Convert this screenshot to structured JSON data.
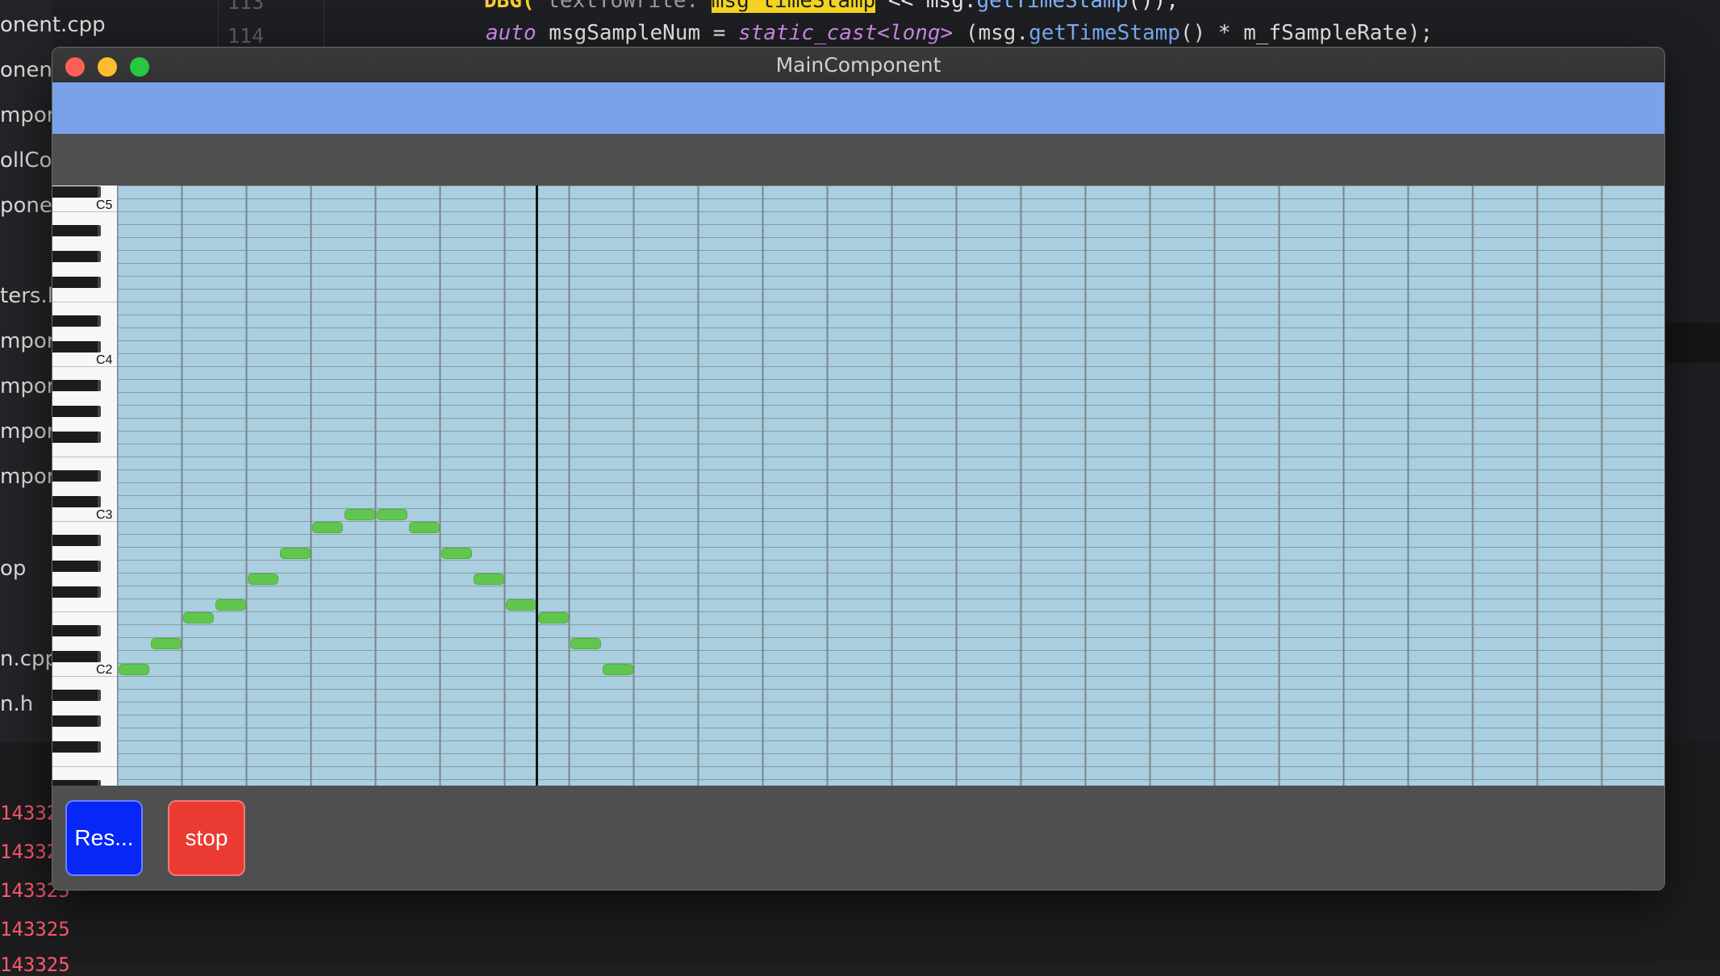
{
  "ide": {
    "line_numbers": [
      "113",
      "114"
    ],
    "code_line_top": {
      "prefix": "DBG(",
      "mid": " textToWrite: ",
      "highlight": "msg timeStamp",
      "rest": " << msg.",
      "fn": "getTimeStamp",
      "end": "());"
    },
    "code_line": {
      "kw": "auto",
      "var": " msgSampleNum = ",
      "cast": "static_cast",
      "type": "<long>",
      "open": " (msg.",
      "fn": "getTimeStamp",
      "rest": "() * m_fSampleRate);"
    },
    "files": [
      "onent.cpp",
      "onent",
      "mpon",
      "ollCo",
      "poner",
      "ters.l",
      "mpor",
      "mpor",
      "mpor",
      "mpor",
      "op",
      "n.cpp",
      "n.h"
    ],
    "console": [
      "14332",
      "14332",
      "143325",
      "143325",
      "143325"
    ]
  },
  "window": {
    "title": "MainComponent"
  },
  "piano_roll": {
    "octave_labels": [
      "C5",
      "C4",
      "C3",
      "C2"
    ],
    "playhead_beat": 6.5,
    "notes": [
      {
        "beat": 0.0,
        "pitch": "C2"
      },
      {
        "beat": 0.5,
        "pitch": "D2"
      },
      {
        "beat": 1.0,
        "pitch": "E2"
      },
      {
        "beat": 1.5,
        "pitch": "F2"
      },
      {
        "beat": 2.0,
        "pitch": "G2"
      },
      {
        "beat": 2.5,
        "pitch": "A2"
      },
      {
        "beat": 3.0,
        "pitch": "B2"
      },
      {
        "beat": 3.5,
        "pitch": "C3"
      },
      {
        "beat": 4.0,
        "pitch": "C3"
      },
      {
        "beat": 4.5,
        "pitch": "B2"
      },
      {
        "beat": 5.0,
        "pitch": "A2"
      },
      {
        "beat": 5.5,
        "pitch": "G2"
      },
      {
        "beat": 6.0,
        "pitch": "F2"
      },
      {
        "beat": 6.5,
        "pitch": "E2"
      },
      {
        "beat": 7.0,
        "pitch": "D2"
      },
      {
        "beat": 7.5,
        "pitch": "C2"
      }
    ],
    "colors": {
      "background": "#a9cfe0",
      "note": "#61c64e",
      "grid": "#8a9aa2"
    }
  },
  "buttons": {
    "reset_label": "Res...",
    "stop_label": "stop",
    "reset_color": "#0627f5",
    "stop_color": "#ea3b33"
  }
}
